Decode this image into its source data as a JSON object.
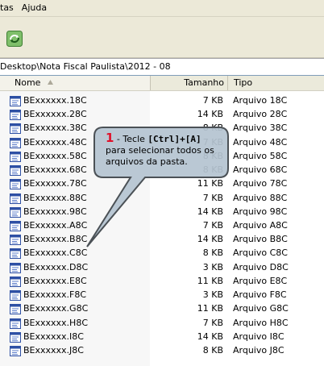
{
  "menubar": {
    "items": [
      "tas",
      "Ajuda"
    ]
  },
  "toolbar": {
    "sync_icon": "sync-icon"
  },
  "address": {
    "path": "Desktop\\Nota Fiscal Paulista\\2012 - 08"
  },
  "columns": {
    "name": "Nome",
    "size": "Tamanho",
    "type": "Tipo"
  },
  "files": [
    {
      "name": "BExxxxxx.18C",
      "size": "7 KB",
      "type": "Arquivo 18C"
    },
    {
      "name": "BExxxxxx.28C",
      "size": "14 KB",
      "type": "Arquivo 28C"
    },
    {
      "name": "BExxxxxx.38C",
      "size": "8 KB",
      "type": "Arquivo 38C"
    },
    {
      "name": "BExxxxxx.48C",
      "size": "7 KB",
      "type": "Arquivo 48C"
    },
    {
      "name": "BExxxxxx.58C",
      "size": "8 KB",
      "type": "Arquivo 58C"
    },
    {
      "name": "BExxxxxx.68C",
      "size": "8 KB",
      "type": "Arquivo 68C"
    },
    {
      "name": "BExxxxxx.78C",
      "size": "11 KB",
      "type": "Arquivo 78C"
    },
    {
      "name": "BExxxxxx.88C",
      "size": "7 KB",
      "type": "Arquivo 88C"
    },
    {
      "name": "BExxxxxx.98C",
      "size": "14 KB",
      "type": "Arquivo 98C"
    },
    {
      "name": "BExxxxxx.A8C",
      "size": "7 KB",
      "type": "Arquivo A8C"
    },
    {
      "name": "BExxxxxx.B8C",
      "size": "14 KB",
      "type": "Arquivo B8C"
    },
    {
      "name": "BExxxxxx.C8C",
      "size": "8 KB",
      "type": "Arquivo C8C"
    },
    {
      "name": "BExxxxxx.D8C",
      "size": "3 KB",
      "type": "Arquivo D8C"
    },
    {
      "name": "BExxxxxx.E8C",
      "size": "11 KB",
      "type": "Arquivo E8C"
    },
    {
      "name": "BExxxxxx.F8C",
      "size": "3 KB",
      "type": "Arquivo F8C"
    },
    {
      "name": "BExxxxxx.G8C",
      "size": "11 KB",
      "type": "Arquivo G8C"
    },
    {
      "name": "BExxxxxx.H8C",
      "size": "7 KB",
      "type": "Arquivo H8C"
    },
    {
      "name": "BExxxxxx.I8C",
      "size": "14 KB",
      "type": "Arquivo I8C"
    },
    {
      "name": "BExxxxxx.J8C",
      "size": "8 KB",
      "type": "Arquivo J8C"
    }
  ],
  "callout": {
    "step": "1",
    "pre": " - Tecle ",
    "keys": "[Ctrl]+[A]",
    "rest": "para selecionar todos os arquivos da pasta."
  },
  "colors": {
    "callout_fill": "#b5c4d1",
    "callout_border": "#4b5156",
    "step": "#e0102a"
  }
}
